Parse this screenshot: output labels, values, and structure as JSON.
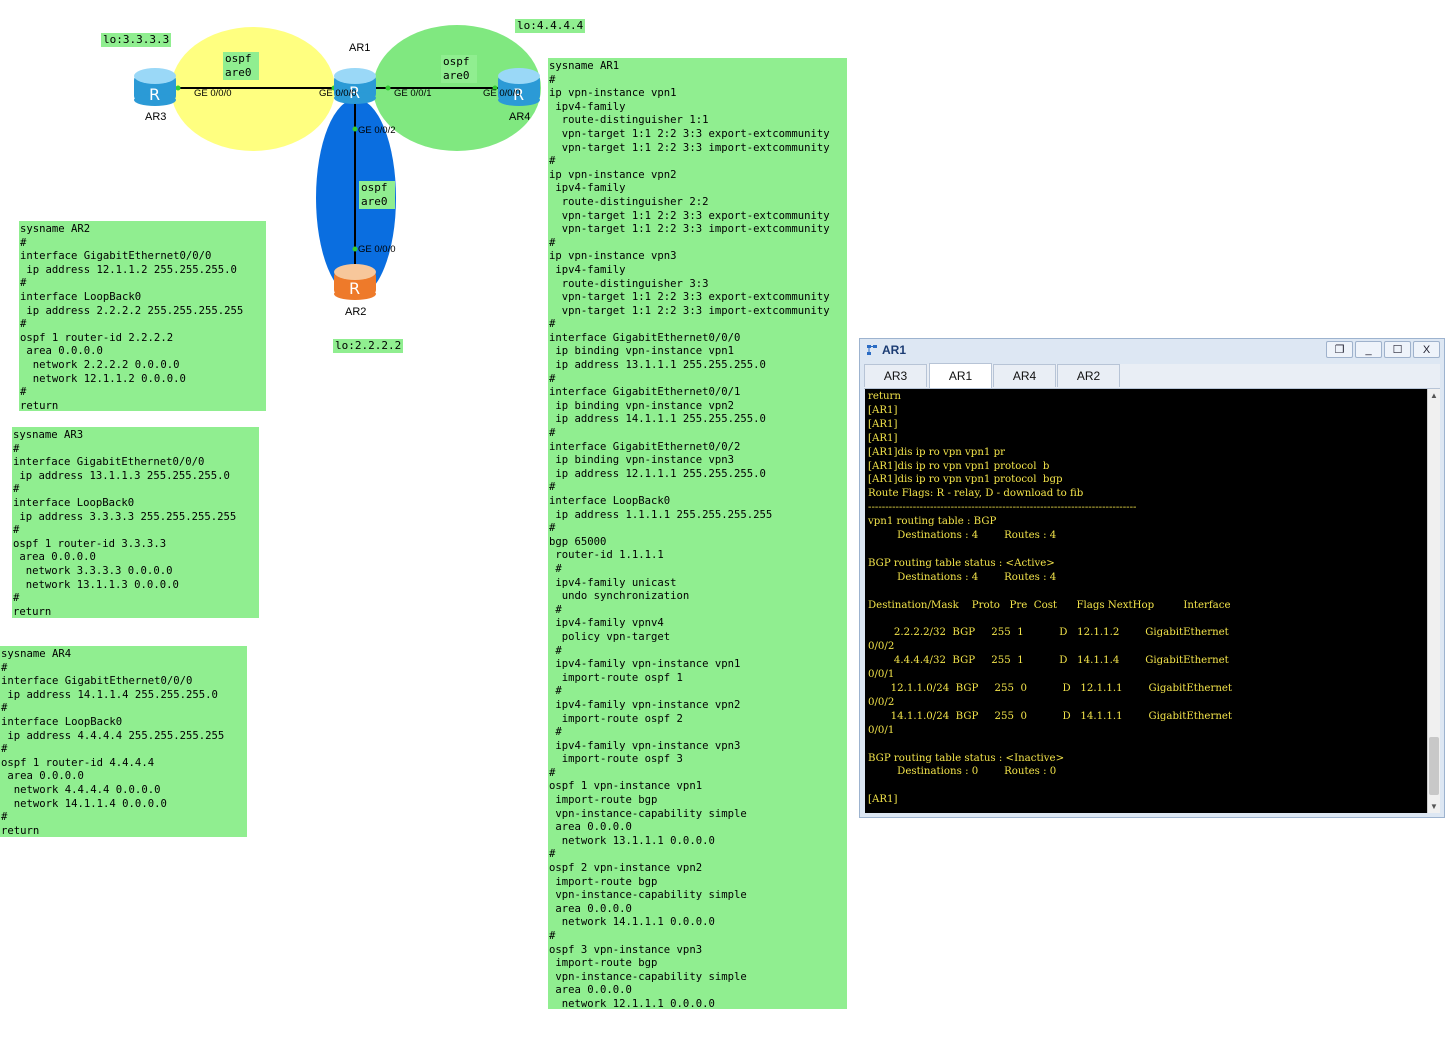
{
  "topology": {
    "routers": {
      "ar1": "AR1",
      "ar2": "AR2",
      "ar3": "AR3",
      "ar4": "AR4"
    },
    "loopback_tags": {
      "ar3": "lo:3.3.3.3",
      "ar4": "lo:4.4.4.4",
      "ar2": "lo:2.2.2.2"
    },
    "ospf_tags": {
      "left": "ospf\nare0",
      "right": "ospf\nare0",
      "bottom": "ospf\nare0"
    },
    "interfaces": {
      "ar3_ge000": "GE 0/0/0",
      "ar1_ge000": "GE 0/0/0",
      "ar1_ge001": "GE 0/0/1",
      "ar4_ge000": "GE 0/0/0",
      "ar1_ge002": "GE 0/0/2",
      "ar2_ge000": "GE 0/0/0"
    },
    "colors": {
      "left_area": "#ffff80",
      "right_area": "#80e880",
      "bottom_area": "#0a6ee0",
      "config_bg": "#90ee90"
    }
  },
  "configs": {
    "ar2": "sysname AR2\n#\ninterface GigabitEthernet0/0/0\n ip address 12.1.1.2 255.255.255.0\n#\ninterface LoopBack0\n ip address 2.2.2.2 255.255.255.255\n#\nospf 1 router-id 2.2.2.2\n area 0.0.0.0\n  network 2.2.2.2 0.0.0.0\n  network 12.1.1.2 0.0.0.0\n#\nreturn",
    "ar3": "sysname AR3\n#\ninterface GigabitEthernet0/0/0\n ip address 13.1.1.3 255.255.255.0\n#\ninterface LoopBack0\n ip address 3.3.3.3 255.255.255.255\n#\nospf 1 router-id 3.3.3.3\n area 0.0.0.0\n  network 3.3.3.3 0.0.0.0\n  network 13.1.1.3 0.0.0.0\n#\nreturn",
    "ar4": "sysname AR4\n#\ninterface GigabitEthernet0/0/0\n ip address 14.1.1.4 255.255.255.0\n#\ninterface LoopBack0\n ip address 4.4.4.4 255.255.255.255\n#\nospf 1 router-id 4.4.4.4\n area 0.0.0.0\n  network 4.4.4.4 0.0.0.0\n  network 14.1.1.4 0.0.0.0\n#\nreturn",
    "ar1": "sysname AR1\n#\nip vpn-instance vpn1\n ipv4-family\n  route-distinguisher 1:1\n  vpn-target 1:1 2:2 3:3 export-extcommunity\n  vpn-target 1:1 2:2 3:3 import-extcommunity\n#\nip vpn-instance vpn2\n ipv4-family\n  route-distinguisher 2:2\n  vpn-target 1:1 2:2 3:3 export-extcommunity\n  vpn-target 1:1 2:2 3:3 import-extcommunity\n#\nip vpn-instance vpn3\n ipv4-family\n  route-distinguisher 3:3\n  vpn-target 1:1 2:2 3:3 export-extcommunity\n  vpn-target 1:1 2:2 3:3 import-extcommunity\n#\ninterface GigabitEthernet0/0/0\n ip binding vpn-instance vpn1\n ip address 13.1.1.1 255.255.255.0\n#\ninterface GigabitEthernet0/0/1\n ip binding vpn-instance vpn2\n ip address 14.1.1.1 255.255.255.0\n#\ninterface GigabitEthernet0/0/2\n ip binding vpn-instance vpn3\n ip address 12.1.1.1 255.255.255.0\n#\ninterface LoopBack0\n ip address 1.1.1.1 255.255.255.255\n#\nbgp 65000\n router-id 1.1.1.1\n #\n ipv4-family unicast\n  undo synchronization\n #\n ipv4-family vpnv4\n  policy vpn-target\n #\n ipv4-family vpn-instance vpn1\n  import-route ospf 1\n #\n ipv4-family vpn-instance vpn2\n  import-route ospf 2\n #\n ipv4-family vpn-instance vpn3\n  import-route ospf 3\n#\nospf 1 vpn-instance vpn1\n import-route bgp\n vpn-instance-capability simple\n area 0.0.0.0\n  network 13.1.1.1 0.0.0.0\n#\nospf 2 vpn-instance vpn2\n import-route bgp\n vpn-instance-capability simple\n area 0.0.0.0\n  network 14.1.1.1 0.0.0.0\n#\nospf 3 vpn-instance vpn3\n import-route bgp\n vpn-instance-capability simple\n area 0.0.0.0\n  network 12.1.1.1 0.0.0.0"
  },
  "terminal_window": {
    "title": "AR1",
    "tabs": [
      "AR3",
      "AR1",
      "AR4",
      "AR2"
    ],
    "active_tab": "AR1",
    "buttons": {
      "restore": "❐",
      "minimize": "_",
      "maximize": "☐",
      "close": "X"
    },
    "output": "return\n[AR1]\n[AR1]\n[AR1]\n[AR1]dis ip ro vpn vpn1 pr\n[AR1]dis ip ro vpn vpn1 protocol  b\n[AR1]dis ip ro vpn vpn1 protocol  bgp\nRoute Flags: R - relay, D - download to fib\n------------------------------------------------------------------------------\nvpn1 routing table : BGP\n         Destinations : 4        Routes : 4\n\nBGP routing table status : <Active>\n         Destinations : 4        Routes : 4\n\nDestination/Mask    Proto   Pre  Cost      Flags NextHop         Interface\n\n        2.2.2.2/32  BGP     255  1           D   12.1.1.2        GigabitEthernet\n0/0/2\n        4.4.4.4/32  BGP     255  1           D   14.1.1.4        GigabitEthernet\n0/0/1\n       12.1.1.0/24  BGP     255  0           D   12.1.1.1        GigabitEthernet\n0/0/2\n       14.1.1.0/24  BGP     255  0           D   14.1.1.1        GigabitEthernet\n0/0/1\n\nBGP routing table status : <Inactive>\n         Destinations : 0        Routes : 0\n\n[AR1]"
  }
}
